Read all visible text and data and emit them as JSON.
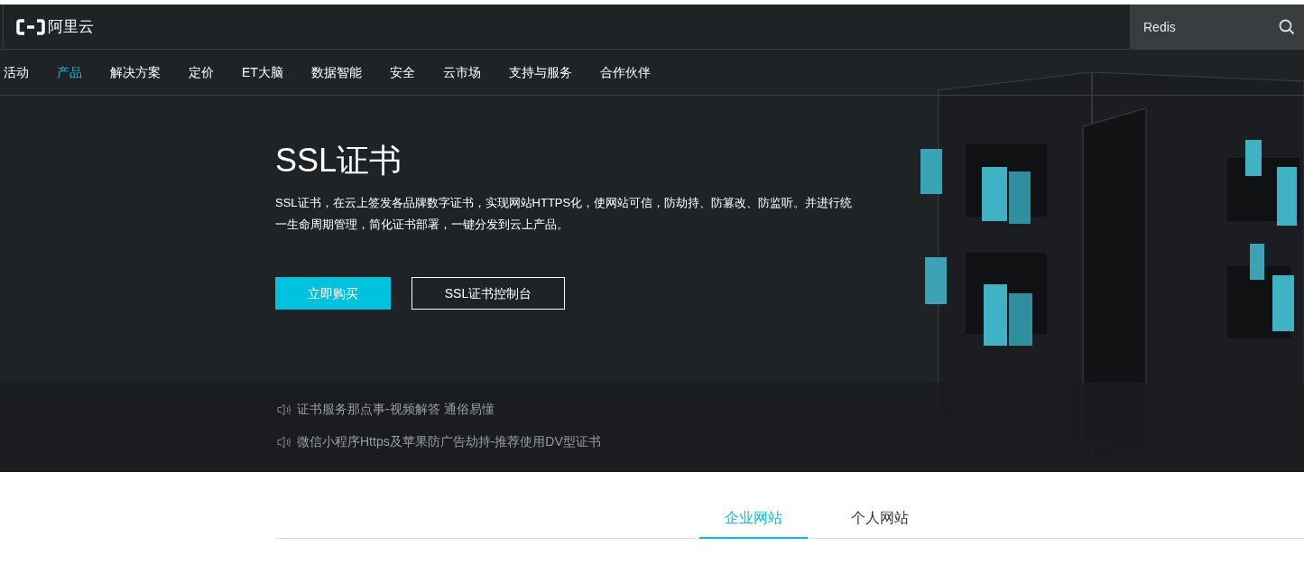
{
  "header": {
    "logo": "阿里云",
    "search": {
      "value": "Redis"
    }
  },
  "nav": [
    {
      "label": "活动",
      "selected": false
    },
    {
      "label": "产品",
      "selected": true
    },
    {
      "label": "解决方案",
      "selected": false
    },
    {
      "label": "定价",
      "selected": false
    },
    {
      "label": "ET大脑",
      "selected": false
    },
    {
      "label": "数据智能",
      "selected": false
    },
    {
      "label": "安全",
      "selected": false
    },
    {
      "label": "云市场",
      "selected": false
    },
    {
      "label": "支持与服务",
      "selected": false
    },
    {
      "label": "合作伙伴",
      "selected": false
    }
  ],
  "hero": {
    "title": "SSL证书",
    "description": "SSL证书，在云上签发各品牌数字证书，实现网站HTTPS化，使网站可信，防劫持、防篡改、防监听。并进行统一生命周期管理，简化证书部署，一键分发到云上产品。",
    "buttons": [
      {
        "kind": "primary",
        "label": "立即购买"
      },
      {
        "kind": "outline",
        "label": "SSL证书控制台"
      }
    ]
  },
  "notices": [
    "证书服务那点事-视频解答 通俗易懂",
    "微信小程序Https及苹果防广告劫持-推荐使用DV型证书"
  ],
  "tabs": [
    {
      "label": "企业网站",
      "selected": true
    },
    {
      "label": "个人网站",
      "selected": false
    }
  ]
}
